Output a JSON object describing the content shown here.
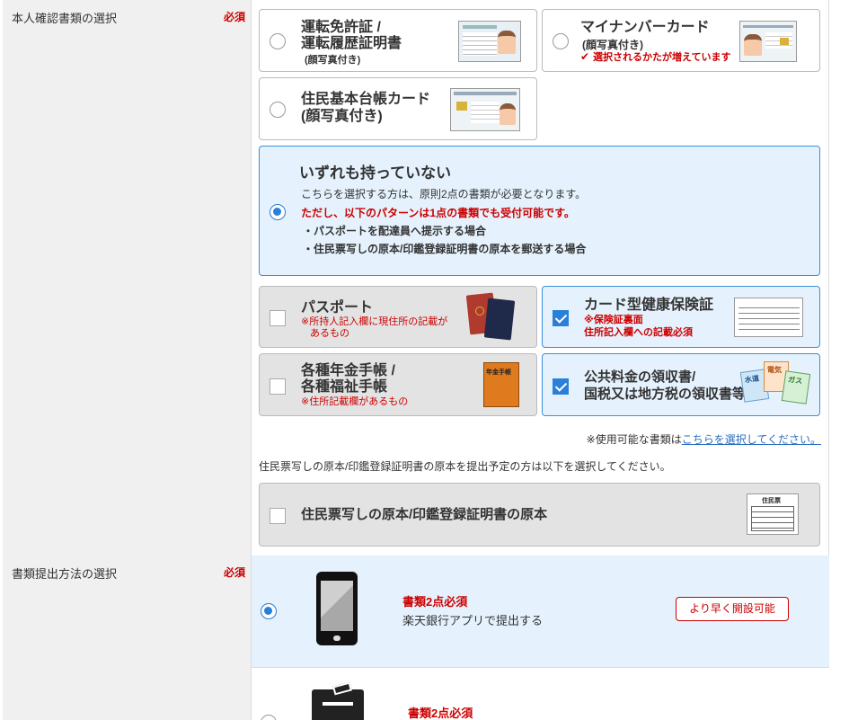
{
  "section1": {
    "label": "本人確認書類の選択",
    "required": "必須",
    "options": {
      "license_l1": "運転免許証 /",
      "license_l2": "運転履歴証明書",
      "license_sub": "(顔写真付き)",
      "mynumber_l1": "マイナンバーカード",
      "mynumber_sub": "(顔写真付き)",
      "mynumber_note": "選択されるかたが増えています",
      "juki_l1": "住民基本台帳カード",
      "juki_l2": "(顔写真付き)"
    },
    "none": {
      "title": "いずれも持っていない",
      "line1": "こちらを選択する方は、原則2点の書類が必要となります。",
      "line2": "ただし、以下のパターンは1点の書類でも受付可能です。",
      "line3": "・パスポートを配達員へ提示する場合",
      "line4": "・住民票写しの原本/印鑑登録証明書の原本を郵送する場合"
    },
    "docs": {
      "passport": "パスポート",
      "passport_note1": "※所持人記入欄に現住所の記載が",
      "passport_note2": "あるもの",
      "health": "カード型健康保険証",
      "health_note1": "※保険証裏面",
      "health_note2": "住所記入欄への記載必須",
      "pension_l1": "各種年金手帳 /",
      "pension_l2": "各種福祉手帳",
      "pension_note": "※住所記載欄があるもの",
      "pension_img": "年金手帳",
      "utility_l1": "公共料金の領収書/",
      "utility_l2": "国税又は地方税の領収書等",
      "utility_tags": [
        "電気",
        "水道",
        "ガス"
      ]
    },
    "usable_prefix": "※使用可能な書類は",
    "usable_link": "こちらを選択してください。",
    "resident_instruction": "住民票写しの原本/印鑑登録証明書の原本を提出予定の方は以下を選択してください。",
    "resident_option": "住民票写しの原本/印鑑登録証明書の原本",
    "resident_img": "住民票"
  },
  "section2": {
    "label": "書類提出方法の選択",
    "required": "必須",
    "app": {
      "need": "書類2点必須",
      "desc": "楽天銀行アプリで提出する",
      "badge": "より早く開設可能"
    },
    "other_need": "書類2点必須"
  },
  "colors": {
    "accent": "#2a7fd8",
    "required": "#cc0000",
    "selected_bg": "#e5f2fd"
  }
}
